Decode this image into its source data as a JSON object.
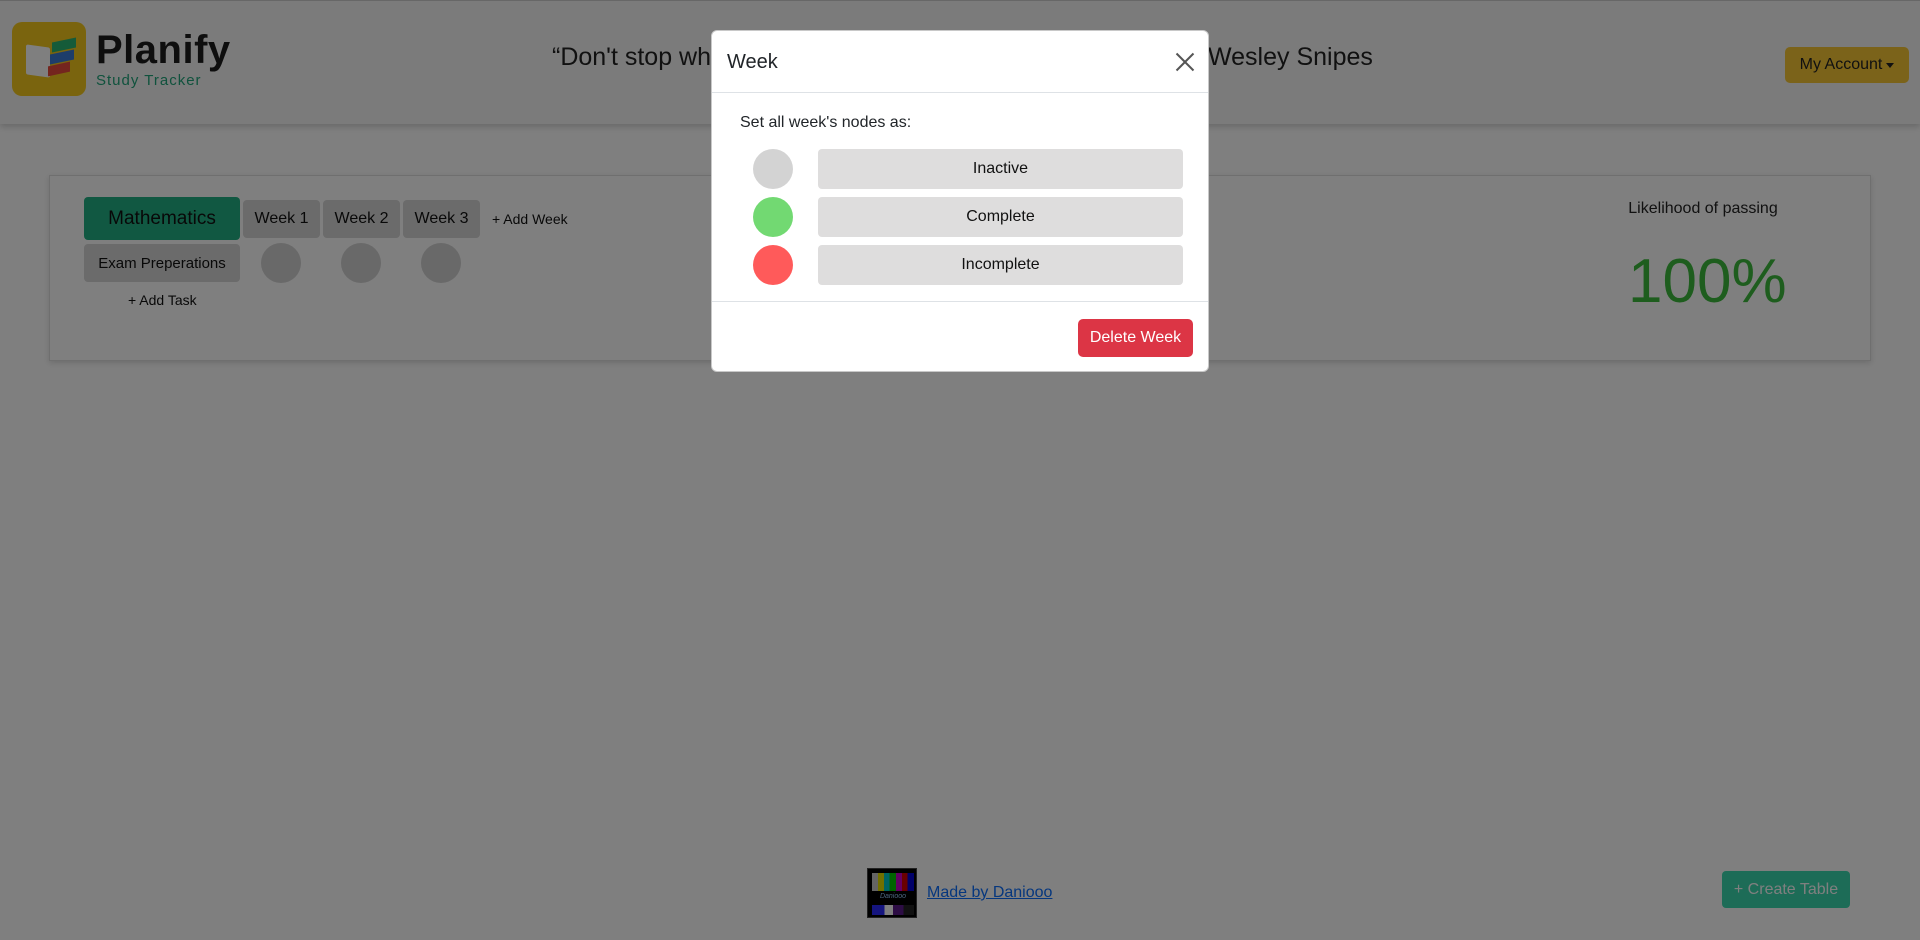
{
  "header": {
    "logo_title": "Planify",
    "logo_subtitle": "Study Tracker",
    "quote_visible_start": "“Don't stop wh",
    "quote_visible_end": "Wesley Snipes",
    "account_label": "My Account"
  },
  "table": {
    "subject": "Mathematics",
    "weeks": [
      "Week 1",
      "Week 2",
      "Week 3"
    ],
    "add_week_label": "+ Add Week",
    "tasks": [
      "Exam Preperations"
    ],
    "add_task_label": "+ Add Task",
    "likelihood_label": "Likelihood of passing",
    "likelihood_value": "100%"
  },
  "footer": {
    "made_by_label": "Made by Daniooo",
    "logo_text": "Daniooo",
    "create_table_label": "+ Create Table"
  },
  "modal": {
    "title": "Week",
    "prompt": "Set all week's nodes as:",
    "options": [
      {
        "label": "Inactive",
        "color": "#d3d3d3"
      },
      {
        "label": "Complete",
        "color": "#72d972"
      },
      {
        "label": "Incomplete",
        "color": "#ff5a5a"
      }
    ],
    "delete_label": "Delete Week"
  },
  "colors": {
    "subject_tab": "#23b085",
    "likelihood": "#3cba3c",
    "delete": "#dc3545",
    "account": "#f6c735",
    "create_table": "#3ad8ae"
  }
}
